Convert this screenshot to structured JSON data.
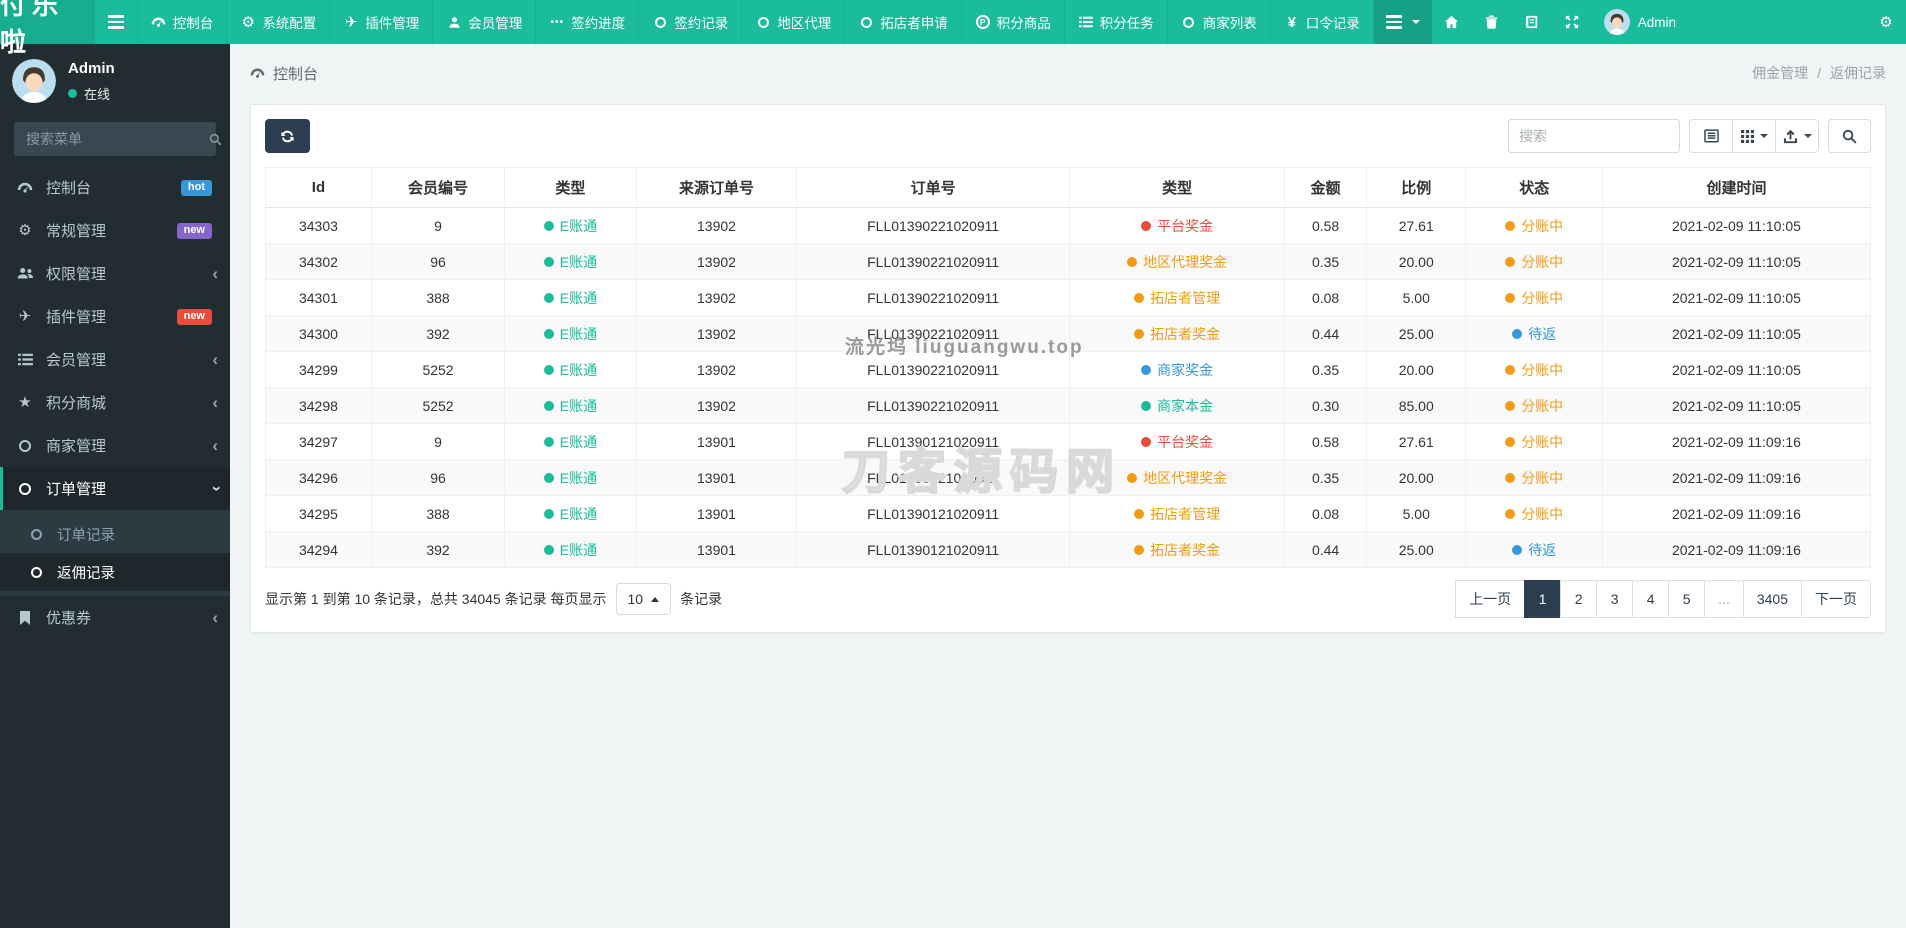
{
  "navbar": {
    "brand": "付乐啦",
    "menu": [
      {
        "label": "控制台"
      },
      {
        "label": "系统配置"
      },
      {
        "label": "插件管理"
      },
      {
        "label": "会员管理"
      },
      {
        "label": "签约进度"
      },
      {
        "label": "签约记录"
      },
      {
        "label": "地区代理"
      },
      {
        "label": "拓店者申请"
      },
      {
        "label": "积分商品"
      },
      {
        "label": "积分任务"
      },
      {
        "label": "商家列表"
      },
      {
        "label": "口令记录"
      }
    ],
    "username": "Admin"
  },
  "sidebar": {
    "user": {
      "name": "Admin",
      "status": "在线"
    },
    "search_placeholder": "搜索菜单",
    "items": [
      {
        "label": "控制台",
        "badge": "hot"
      },
      {
        "label": "常规管理",
        "badge": "new"
      },
      {
        "label": "权限管理"
      },
      {
        "label": "插件管理",
        "badge": "new"
      },
      {
        "label": "会员管理"
      },
      {
        "label": "积分商城"
      },
      {
        "label": "商家管理"
      },
      {
        "label": "订单管理"
      },
      {
        "label": "优惠券"
      }
    ],
    "submenu": [
      {
        "label": "订单记录"
      },
      {
        "label": "返佣记录"
      }
    ]
  },
  "breadcrumb": {
    "left": "控制台",
    "parent": "佣金管理",
    "separator": "/",
    "current": "返佣记录"
  },
  "toolbar": {
    "search_placeholder": "搜索"
  },
  "table": {
    "headers": [
      "Id",
      "会员编号",
      "类型",
      "来源订单号",
      "订单号",
      "类型",
      "金额",
      "比例",
      "状态",
      "创建时间"
    ],
    "rows": [
      {
        "id": "34303",
        "member": "9",
        "type1": {
          "label": "E账通",
          "color": "teal"
        },
        "source": "13902",
        "order": "FLL01390221020911",
        "type2": {
          "label": "平台奖金",
          "color": "red"
        },
        "amount": "0.58",
        "ratio": "27.61",
        "status": {
          "label": "分账中",
          "color": "orange"
        },
        "created": "2021-02-09 11:10:05"
      },
      {
        "id": "34302",
        "member": "96",
        "type1": {
          "label": "E账通",
          "color": "teal"
        },
        "source": "13902",
        "order": "FLL01390221020911",
        "type2": {
          "label": "地区代理奖金",
          "color": "orange"
        },
        "amount": "0.35",
        "ratio": "20.00",
        "status": {
          "label": "分账中",
          "color": "orange"
        },
        "created": "2021-02-09 11:10:05"
      },
      {
        "id": "34301",
        "member": "388",
        "type1": {
          "label": "E账通",
          "color": "teal"
        },
        "source": "13902",
        "order": "FLL01390221020911",
        "type2": {
          "label": "拓店者管理",
          "color": "orange"
        },
        "amount": "0.08",
        "ratio": "5.00",
        "status": {
          "label": "分账中",
          "color": "orange"
        },
        "created": "2021-02-09 11:10:05"
      },
      {
        "id": "34300",
        "member": "392",
        "type1": {
          "label": "E账通",
          "color": "teal"
        },
        "source": "13902",
        "order": "FLL01390221020911",
        "type2": {
          "label": "拓店者奖金",
          "color": "orange"
        },
        "amount": "0.44",
        "ratio": "25.00",
        "status": {
          "label": "待返",
          "color": "blue"
        },
        "created": "2021-02-09 11:10:05"
      },
      {
        "id": "34299",
        "member": "5252",
        "type1": {
          "label": "E账通",
          "color": "teal"
        },
        "source": "13902",
        "order": "FLL01390221020911",
        "type2": {
          "label": "商家奖金",
          "color": "blue"
        },
        "amount": "0.35",
        "ratio": "20.00",
        "status": {
          "label": "分账中",
          "color": "orange"
        },
        "created": "2021-02-09 11:10:05"
      },
      {
        "id": "34298",
        "member": "5252",
        "type1": {
          "label": "E账通",
          "color": "teal"
        },
        "source": "13902",
        "order": "FLL01390221020911",
        "type2": {
          "label": "商家本金",
          "color": "teal"
        },
        "amount": "0.30",
        "ratio": "85.00",
        "status": {
          "label": "分账中",
          "color": "orange"
        },
        "created": "2021-02-09 11:10:05"
      },
      {
        "id": "34297",
        "member": "9",
        "type1": {
          "label": "E账通",
          "color": "teal"
        },
        "source": "13901",
        "order": "FLL01390121020911",
        "type2": {
          "label": "平台奖金",
          "color": "red"
        },
        "amount": "0.58",
        "ratio": "27.61",
        "status": {
          "label": "分账中",
          "color": "orange"
        },
        "created": "2021-02-09 11:09:16"
      },
      {
        "id": "34296",
        "member": "96",
        "type1": {
          "label": "E账通",
          "color": "teal"
        },
        "source": "13901",
        "order": "FLL01390121020911",
        "type2": {
          "label": "地区代理奖金",
          "color": "orange"
        },
        "amount": "0.35",
        "ratio": "20.00",
        "status": {
          "label": "分账中",
          "color": "orange"
        },
        "created": "2021-02-09 11:09:16"
      },
      {
        "id": "34295",
        "member": "388",
        "type1": {
          "label": "E账通",
          "color": "teal"
        },
        "source": "13901",
        "order": "FLL01390121020911",
        "type2": {
          "label": "拓店者管理",
          "color": "orange"
        },
        "amount": "0.08",
        "ratio": "5.00",
        "status": {
          "label": "分账中",
          "color": "orange"
        },
        "created": "2021-02-09 11:09:16"
      },
      {
        "id": "34294",
        "member": "392",
        "type1": {
          "label": "E账通",
          "color": "teal"
        },
        "source": "13901",
        "order": "FLL01390121020911",
        "type2": {
          "label": "拓店者奖金",
          "color": "orange"
        },
        "amount": "0.44",
        "ratio": "25.00",
        "status": {
          "label": "待返",
          "color": "blue"
        },
        "created": "2021-02-09 11:09:16"
      }
    ]
  },
  "footer": {
    "summary_prefix": "显示第 1 到第 10 条记录，总共 34045 条记录 每页显示",
    "page_size": "10",
    "summary_suffix": "条记录",
    "pages": [
      {
        "label": "上一页",
        "state": "normal"
      },
      {
        "label": "1",
        "state": "active"
      },
      {
        "label": "2",
        "state": "normal"
      },
      {
        "label": "3",
        "state": "normal"
      },
      {
        "label": "4",
        "state": "normal"
      },
      {
        "label": "5",
        "state": "normal"
      },
      {
        "label": "...",
        "state": "gap"
      },
      {
        "label": "3405",
        "state": "normal"
      },
      {
        "label": "下一页",
        "state": "normal"
      }
    ]
  },
  "watermarks": {
    "small": "流光坞 liuguangwu.top",
    "large": "刀客源码网"
  },
  "icon_glyphs": {
    "gear": "⚙",
    "plane": "✈",
    "star": "★",
    "yen": "¥",
    "ellipsis": "•••",
    "chevron": "‹",
    "p": "P"
  },
  "colors": {
    "accent": "#1abc9c",
    "dark": "#2c3e50",
    "red": "#e74c3c",
    "orange": "#f39c12",
    "blue": "#3498db",
    "teal": "#1abc9c",
    "badge_hot": "#3498db",
    "badge_new_purple": "#8666c8",
    "badge_new_red": "#e74c3c"
  }
}
